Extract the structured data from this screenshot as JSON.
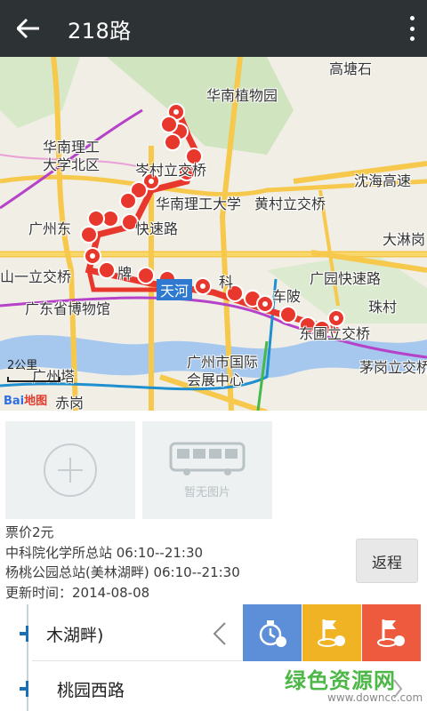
{
  "appbar": {
    "title": "218路",
    "back_icon": "arrow-left-icon",
    "menu_icon": "overflow-menu-icon"
  },
  "map": {
    "labels": {
      "gaotangshi": "高塘石",
      "botanical": "华南植物园",
      "scut_north": "华南理工\n大学北区",
      "censun": "岑村立交桥",
      "scut": "华南理工大学",
      "huangcun": "黄村立交桥",
      "shenhai": "沈海高速",
      "guangzhou_east": "广州东",
      "expressway": "快速路",
      "dalinggang": "大淋岗",
      "shanyi": "山一立交桥",
      "pai": "牌",
      "tianhe": "天河",
      "ke": "科",
      "guangyuan": "广园快速路",
      "chepo": "车陂",
      "zhucun": "珠村",
      "museum": "广东省博物馆",
      "dong_bridge": "东圃立交桥",
      "maogang": "茅岗立交桥",
      "canton_tower": "广州塔",
      "expo_center": "广州市国际\n会展中心",
      "chigang": "赤岗"
    },
    "scale": "2公里",
    "logo": "Bai地图"
  },
  "photos": {
    "add_icon": "add-photo-icon",
    "no_image_caption": "暂无图片",
    "bus_icon": "bus-icon"
  },
  "info": {
    "fare": "票价2元",
    "stop_a": "中科院化学所总站 06:10--21:30",
    "stop_b": "杨桃公园总站(美林湖畔) 06:10--21:30",
    "updated": "更新时间：2014-08-08"
  },
  "return_button": "返程",
  "stops": [
    {
      "name": "木湖畔)"
    },
    {
      "name": "桃园西路"
    }
  ],
  "actions": [
    {
      "name": "remind",
      "icon": "stopwatch-remind-icon",
      "color": "#5c8fd8"
    },
    {
      "name": "start",
      "icon": "start-stop-icon",
      "color": "#f0b323"
    },
    {
      "name": "end",
      "icon": "end-flag-icon",
      "color": "#ed5a3d"
    }
  ],
  "watermark": {
    "line1": "绿色资源网",
    "line2": "www.downcc.com"
  }
}
